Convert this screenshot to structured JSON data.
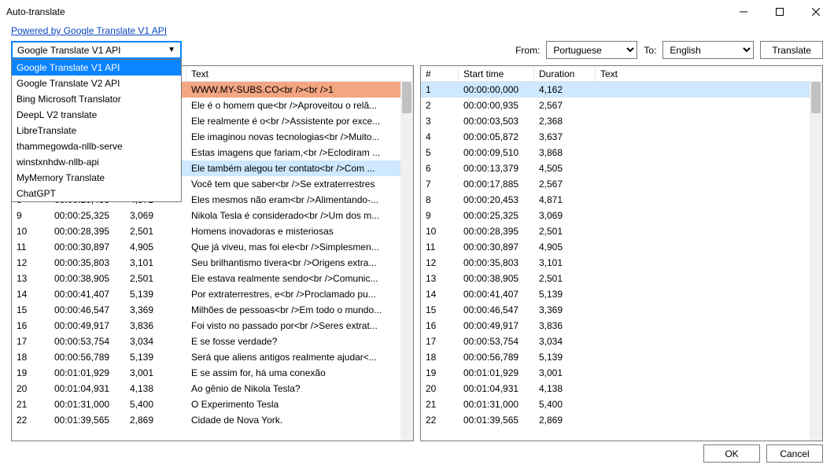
{
  "window": {
    "title": "Auto-translate"
  },
  "link": {
    "text": "Powered by Google Translate V1 API"
  },
  "api": {
    "selected": "Google Translate V1 API",
    "options": [
      "Google Translate V1 API",
      "Google Translate V2 API",
      "Bing Microsoft Translator",
      "DeepL V2 translate",
      "LibreTranslate",
      "thammegowda-nllb-serve",
      "winstxnhdw-nllb-api",
      "MyMemory Translate",
      "ChatGPT"
    ]
  },
  "from": {
    "label": "From:",
    "value": "Portuguese"
  },
  "to": {
    "label": "To:",
    "value": "English"
  },
  "translate_btn": "Translate",
  "headers": {
    "num": "#",
    "start": "Start time",
    "dur": "Duration",
    "text": "Text"
  },
  "left_visible": [
    {
      "n": "8",
      "start": "00:00:20,453",
      "dur": "4,871"
    },
    {
      "n": "9",
      "start": "00:00:25,325",
      "dur": "3,069"
    },
    {
      "n": "10",
      "start": "00:00:28,395",
      "dur": "2,501"
    },
    {
      "n": "11",
      "start": "00:00:30,897",
      "dur": "4,905"
    },
    {
      "n": "12",
      "start": "00:00:35,803",
      "dur": "3,101"
    },
    {
      "n": "13",
      "start": "00:00:38,905",
      "dur": "2,501"
    },
    {
      "n": "14",
      "start": "00:00:41,407",
      "dur": "5,139"
    },
    {
      "n": "15",
      "start": "00:00:46,547",
      "dur": "3,369"
    },
    {
      "n": "16",
      "start": "00:00:49,917",
      "dur": "3,836"
    },
    {
      "n": "17",
      "start": "00:00:53,754",
      "dur": "3,034"
    },
    {
      "n": "18",
      "start": "00:00:56,789",
      "dur": "5,139"
    },
    {
      "n": "19",
      "start": "00:01:01,929",
      "dur": "3,001"
    },
    {
      "n": "20",
      "start": "00:01:04,931",
      "dur": "4,138"
    },
    {
      "n": "21",
      "start": "00:01:31,000",
      "dur": "5,400"
    },
    {
      "n": "22",
      "start": "00:01:39,565",
      "dur": "2,869"
    }
  ],
  "left_texts": [
    {
      "text": "WWW.MY-SUBS.CO<br /><br />1",
      "cls": "orange"
    },
    {
      "text": "Ele é o homem que<br />Aproveitou o relâ...",
      "cls": ""
    },
    {
      "text": "Ele realmente é o<br />Assistente por exce...",
      "cls": ""
    },
    {
      "text": "Ele imaginou novas tecnologias<br />Muito...",
      "cls": ""
    },
    {
      "text": "Estas imagens que fariam,<br />Eclodiram ...",
      "cls": ""
    },
    {
      "text": "Ele também alegou ter contato<br />Com ...",
      "cls": "blue"
    },
    {
      "text": "Você tem que saber<br />Se extraterrestres",
      "cls": ""
    },
    {
      "text": "Eles mesmos não eram<br />Alimentando-...",
      "cls": ""
    },
    {
      "text": "Nikola Tesla é considerado<br />Um dos m...",
      "cls": ""
    },
    {
      "text": "Homens inovadoras e misteriosas",
      "cls": ""
    },
    {
      "text": "Que já viveu, mas foi ele<br />Simplesmen...",
      "cls": ""
    },
    {
      "text": "Seu brilhantismo tivera<br />Origens extra...",
      "cls": ""
    },
    {
      "text": "Ele estava realmente sendo<br />Comunic...",
      "cls": ""
    },
    {
      "text": "Por extraterrestres, e<br />Proclamado pu...",
      "cls": ""
    },
    {
      "text": "Milhões de pessoas<br />Em todo o mundo...",
      "cls": ""
    },
    {
      "text": "Foi visto no passado por<br />Seres extrat...",
      "cls": ""
    },
    {
      "text": "E se fosse verdade?",
      "cls": ""
    },
    {
      "text": "Será que aliens antigos realmente ajudar<...",
      "cls": ""
    },
    {
      "text": "E se assim for, há uma conexão",
      "cls": ""
    },
    {
      "text": "Ao gênio de Nikola Tesla?",
      "cls": ""
    },
    {
      "text": "O Experimento Tesla",
      "cls": ""
    },
    {
      "text": "Cidade de Nova York.",
      "cls": ""
    }
  ],
  "right_rows": [
    {
      "n": "1",
      "start": "00:00:00,000",
      "dur": "4,162",
      "text": "",
      "cls": "blue"
    },
    {
      "n": "2",
      "start": "00:00:00,935",
      "dur": "2,567",
      "text": ""
    },
    {
      "n": "3",
      "start": "00:00:03,503",
      "dur": "2,368",
      "text": ""
    },
    {
      "n": "4",
      "start": "00:00:05,872",
      "dur": "3,637",
      "text": ""
    },
    {
      "n": "5",
      "start": "00:00:09,510",
      "dur": "3,868",
      "text": ""
    },
    {
      "n": "6",
      "start": "00:00:13,379",
      "dur": "4,505",
      "text": ""
    },
    {
      "n": "7",
      "start": "00:00:17,885",
      "dur": "2,567",
      "text": ""
    },
    {
      "n": "8",
      "start": "00:00:20,453",
      "dur": "4,871",
      "text": ""
    },
    {
      "n": "9",
      "start": "00:00:25,325",
      "dur": "3,069",
      "text": ""
    },
    {
      "n": "10",
      "start": "00:00:28,395",
      "dur": "2,501",
      "text": ""
    },
    {
      "n": "11",
      "start": "00:00:30,897",
      "dur": "4,905",
      "text": ""
    },
    {
      "n": "12",
      "start": "00:00:35,803",
      "dur": "3,101",
      "text": ""
    },
    {
      "n": "13",
      "start": "00:00:38,905",
      "dur": "2,501",
      "text": ""
    },
    {
      "n": "14",
      "start": "00:00:41,407",
      "dur": "5,139",
      "text": ""
    },
    {
      "n": "15",
      "start": "00:00:46,547",
      "dur": "3,369",
      "text": ""
    },
    {
      "n": "16",
      "start": "00:00:49,917",
      "dur": "3,836",
      "text": ""
    },
    {
      "n": "17",
      "start": "00:00:53,754",
      "dur": "3,034",
      "text": ""
    },
    {
      "n": "18",
      "start": "00:00:56,789",
      "dur": "5,139",
      "text": ""
    },
    {
      "n": "19",
      "start": "00:01:01,929",
      "dur": "3,001",
      "text": ""
    },
    {
      "n": "20",
      "start": "00:01:04,931",
      "dur": "4,138",
      "text": ""
    },
    {
      "n": "21",
      "start": "00:01:31,000",
      "dur": "5,400",
      "text": ""
    },
    {
      "n": "22",
      "start": "00:01:39,565",
      "dur": "2,869",
      "text": ""
    }
  ],
  "footer": {
    "ok": "OK",
    "cancel": "Cancel"
  }
}
